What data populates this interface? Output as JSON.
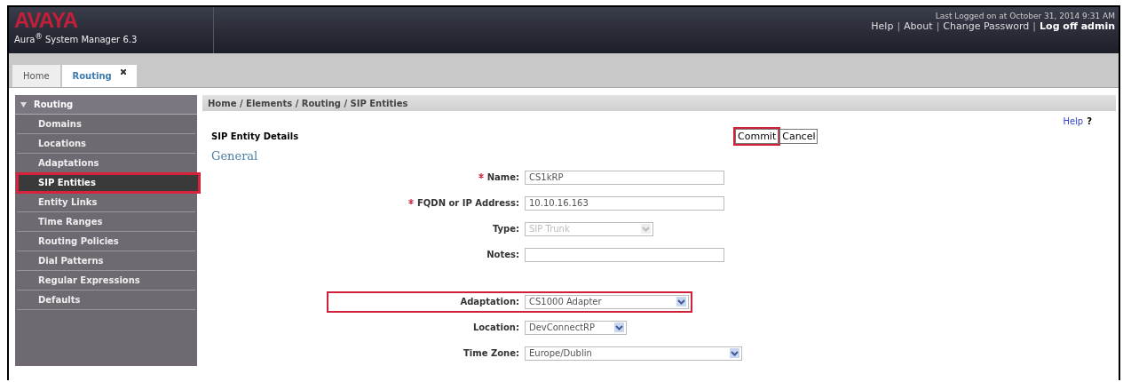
{
  "header": {
    "logo": "AVAYA",
    "product": "Aura$^{®}$ System Manager 6.3",
    "last_login": "Last Logged on at October 31, 2014 9:31 AM",
    "separator": "|",
    "links": [
      {
        "label": "Help",
        "bold": false
      },
      {
        "label": "About",
        "bold": false
      },
      {
        "label": "Change Password",
        "bold": false
      },
      {
        "label": "Log off admin",
        "bold": true
      }
    ]
  },
  "tabs": [
    {
      "label": "Home",
      "selected": false,
      "closable": false
    },
    {
      "label": "Routing",
      "selected": true,
      "closable": true
    }
  ],
  "sidebar": {
    "title": "Routing",
    "expanded": true,
    "items": [
      {
        "label": "Domains",
        "selected": false,
        "highlighted": false
      },
      {
        "label": "Locations",
        "selected": false,
        "highlighted": false
      },
      {
        "label": "Adaptations",
        "selected": false,
        "highlighted": false
      },
      {
        "label": "SIP Entities",
        "selected": true,
        "highlighted": true
      },
      {
        "label": "Entity Links",
        "selected": false,
        "highlighted": false
      },
      {
        "label": "Time Ranges",
        "selected": false,
        "highlighted": false
      },
      {
        "label": "Routing Policies",
        "selected": false,
        "highlighted": false
      },
      {
        "label": "Dial Patterns",
        "selected": false,
        "highlighted": false
      },
      {
        "label": "Regular Expressions",
        "selected": false,
        "highlighted": false
      },
      {
        "label": "Defaults",
        "selected": false,
        "highlighted": false
      }
    ]
  },
  "breadcrumb": "Home / Elements / Routing / SIP Entities",
  "help": {
    "label": "Help",
    "icon": "?"
  },
  "section_title": "SIP Entity Details",
  "buttons": [
    {
      "label": "Commit",
      "highlighted": true
    },
    {
      "label": "Cancel",
      "highlighted": false
    }
  ],
  "group_title": "General",
  "field_groups": [
    [
      {
        "label": "Name:",
        "required": true,
        "kind": "text",
        "value": "CS1kRP",
        "disabled": false,
        "highlighted": false
      },
      {
        "label": "FQDN or IP Address:",
        "required": true,
        "kind": "text",
        "value": "10.10.16.163",
        "disabled": false,
        "highlighted": false
      },
      {
        "label": "Type:",
        "required": false,
        "kind": "select",
        "value": "SIP Trunk",
        "disabled": true,
        "highlighted": false
      },
      {
        "label": "Notes:",
        "required": false,
        "kind": "text",
        "disabled": false,
        "highlighted": false
      }
    ],
    [
      {
        "label": "Adaptation:",
        "required": false,
        "kind": "select",
        "value": "CS1000 Adapter",
        "disabled": false,
        "highlighted": true
      },
      {
        "label": "Location:",
        "required": false,
        "kind": "select",
        "value": "DevConnectRP",
        "disabled": false,
        "highlighted": false
      },
      {
        "label": "Time Zone:",
        "required": false,
        "kind": "select",
        "value": "Europe/Dublin",
        "disabled": false,
        "highlighted": false
      }
    ]
  ]
}
